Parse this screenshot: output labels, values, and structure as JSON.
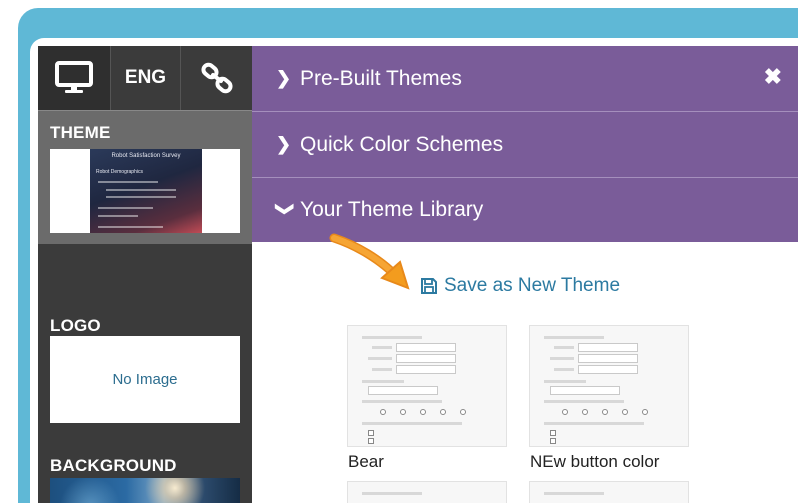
{
  "toolbar": {
    "monitor_icon": "monitor-icon",
    "language_label": "ENG",
    "link_icon": "link-icon"
  },
  "sidebar": {
    "theme_label": "THEME",
    "theme_preview": {
      "title": "Robot Satisfaction Survey",
      "subtitle": "Robot Demographics"
    },
    "logo_label": "LOGO",
    "logo_placeholder": "No Image",
    "background_label": "BACKGROUND"
  },
  "accordion": {
    "prebuilt_label": "Pre-Built Themes",
    "quick_colors_label": "Quick Color Schemes",
    "library_label": "Your Theme Library",
    "close_icon": "close-icon"
  },
  "library": {
    "save_label": "Save as New Theme",
    "themes": [
      {
        "name": "Bear"
      },
      {
        "name": "NEw button color"
      }
    ]
  },
  "colors": {
    "accent_purple": "#7a5c99",
    "frame_blue": "#5fb8d6",
    "link_blue": "#2c7aa1",
    "arrow_orange": "#f39c1e"
  }
}
